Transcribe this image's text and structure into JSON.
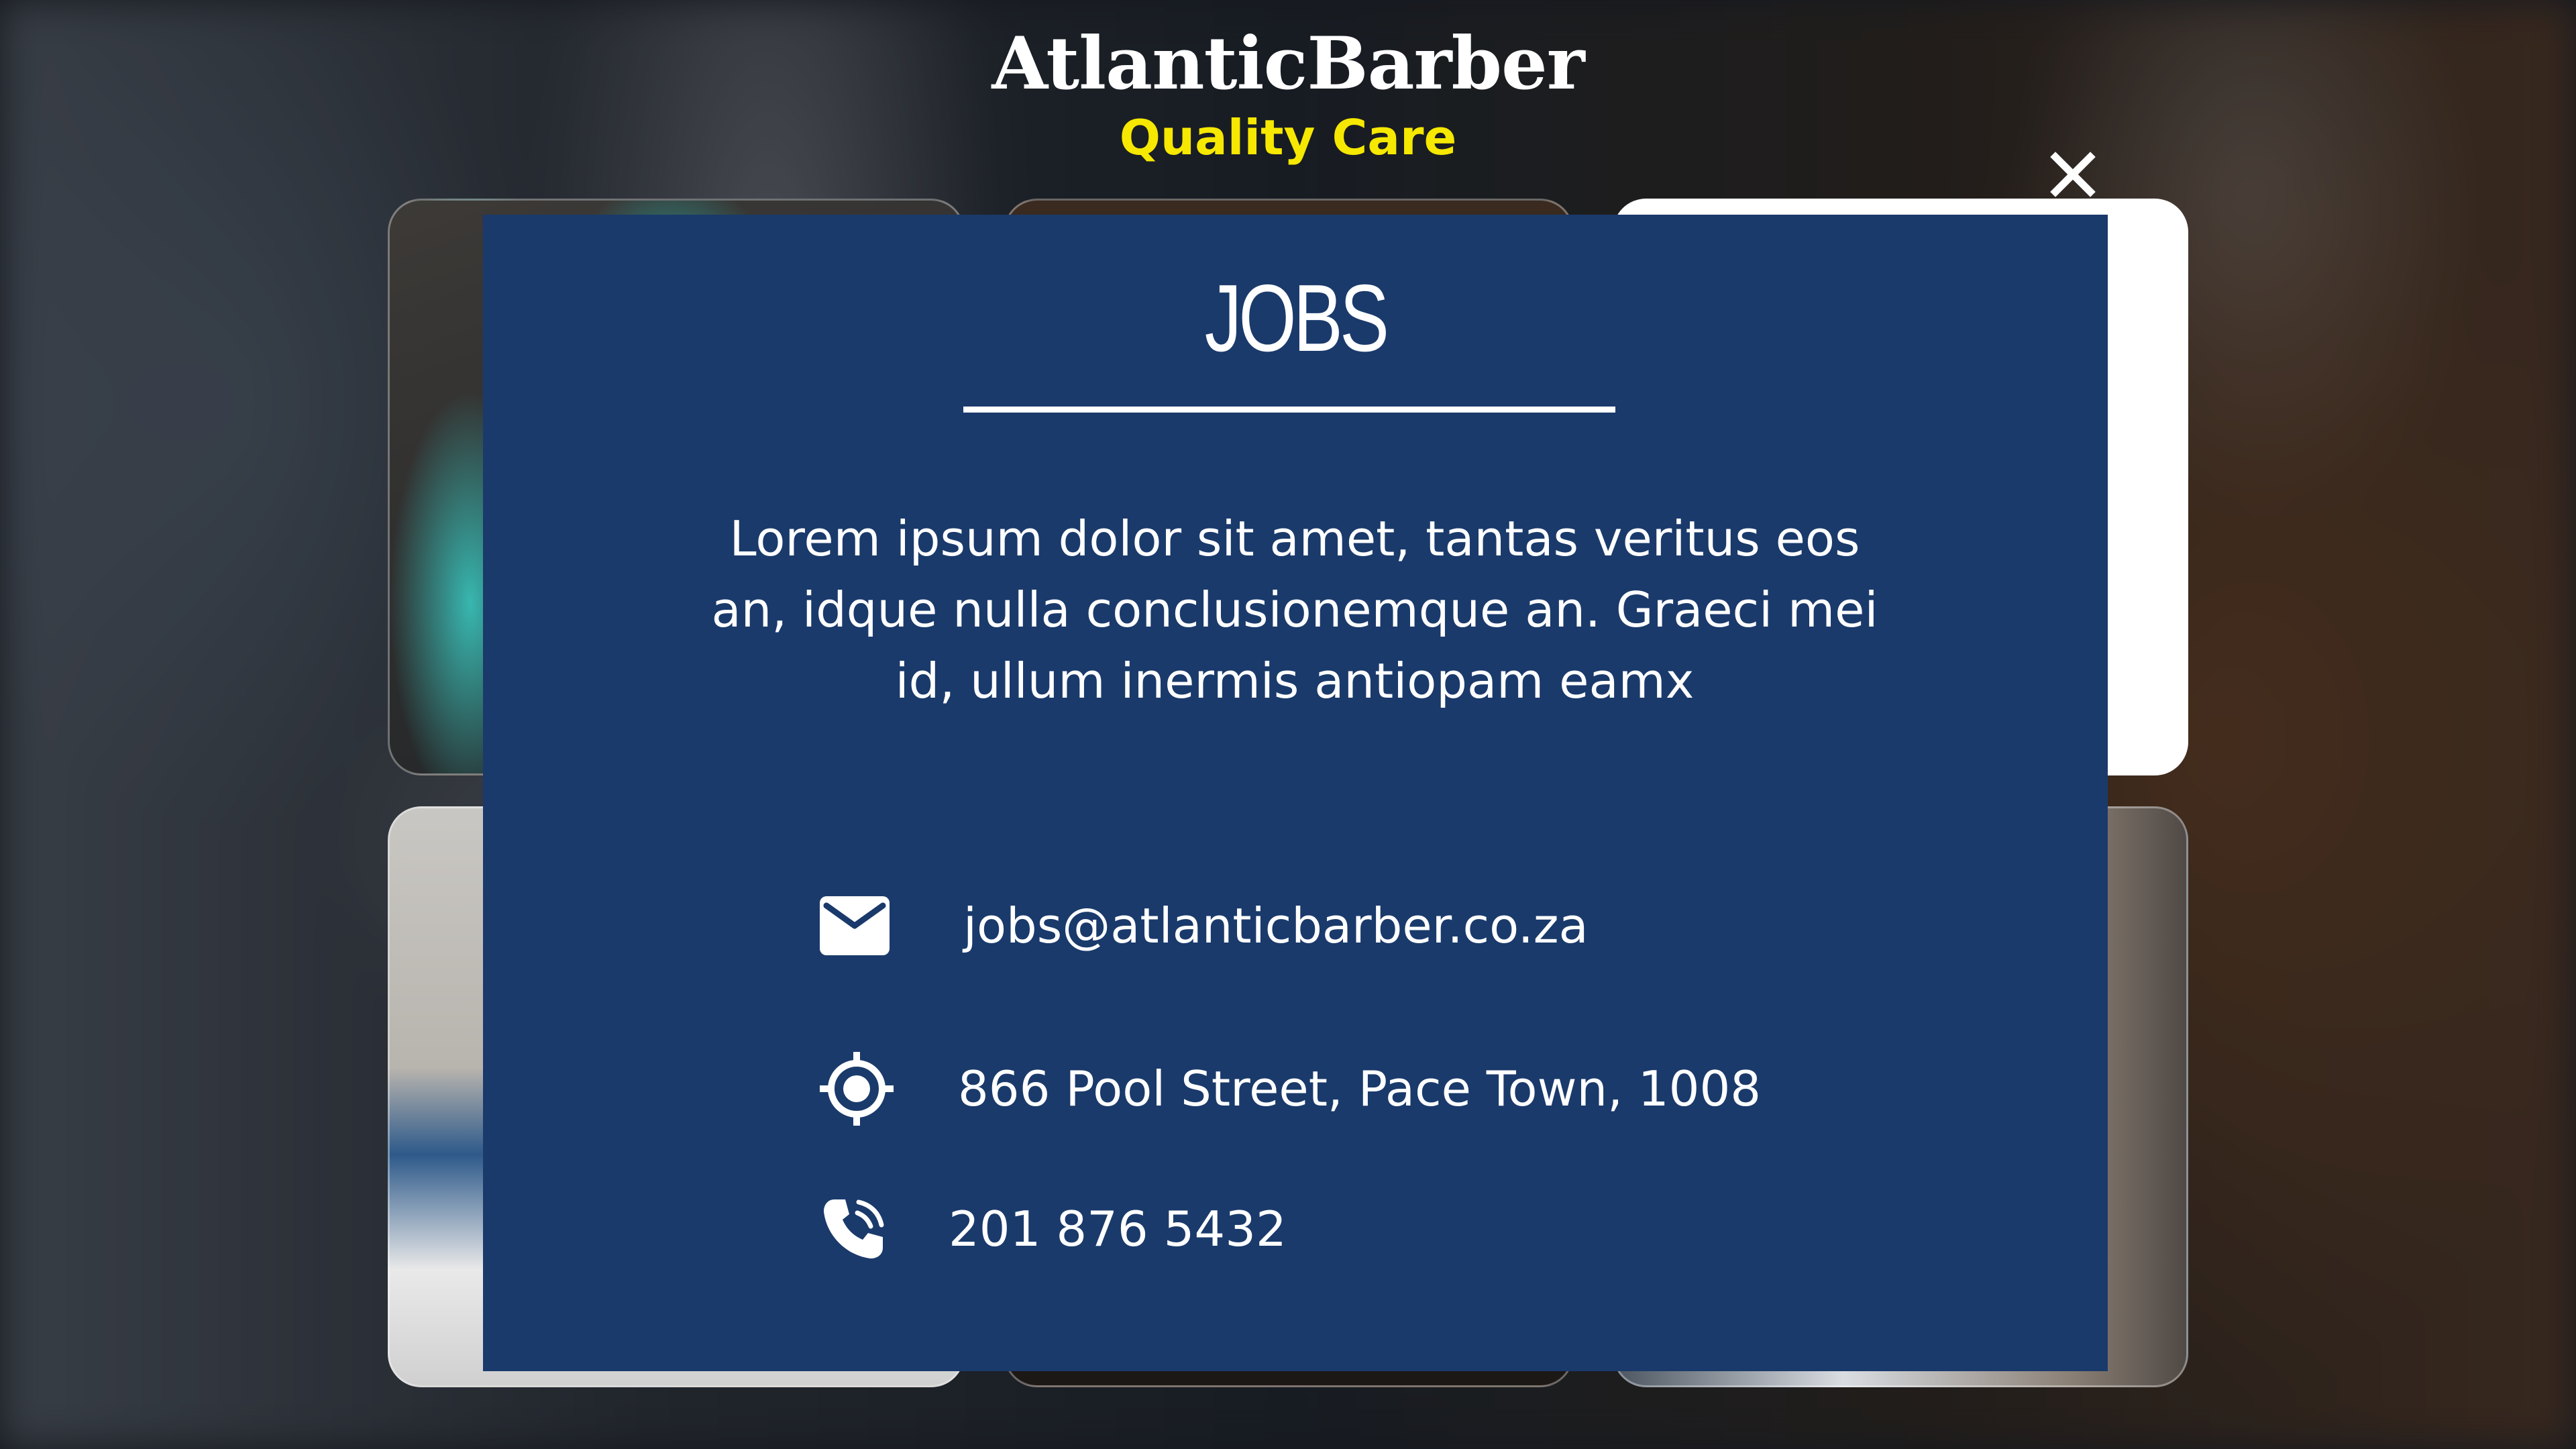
{
  "brand": {
    "title": "AtlanticBarber",
    "tagline": "Quality Care",
    "tagline_color": "#f6e800"
  },
  "modal": {
    "title": "JOBS",
    "background_color": "#1a3a6b",
    "description": "Lorem ipsum dolor sit amet, tantas veritus eos an, idque nulla conclusionemque an. Graeci mei id, ullum inermis antiopam eamx",
    "close_icon": "close-icon",
    "contacts": [
      {
        "icon": "mail-icon",
        "text": "jobs@atlanticbarber.co.za"
      },
      {
        "icon": "location-target-icon",
        "text": "866 Pool Street, Pace Town, 1008"
      },
      {
        "icon": "phone-icon",
        "text": "201 876 5432"
      }
    ]
  }
}
